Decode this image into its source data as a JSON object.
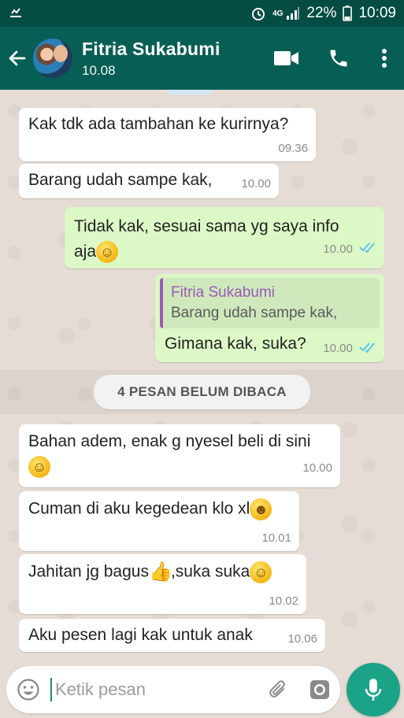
{
  "status_bar": {
    "network": "4G",
    "battery": "22%",
    "clock": "10:09"
  },
  "header": {
    "contact_name": "Fitria Sukabumi",
    "last_seen": "10.08"
  },
  "messages": [
    {
      "dir": "in",
      "text": "Kak tdk ada tambahan ke kurirnya?",
      "time": "09.36"
    },
    {
      "dir": "in",
      "text": "Barang udah sampe kak,",
      "time": "10.00"
    },
    {
      "dir": "out",
      "text": "Tidak kak, sesuai sama yg saya info",
      "text2": "aja",
      "emoji": "smile",
      "time": "10.00"
    },
    {
      "dir": "out",
      "quote_name": "Fitria Sukabumi",
      "quote_text": "Barang udah sampe kak,",
      "text": "Gimana kak, suka?",
      "time": "10.00"
    },
    {
      "dir": "in",
      "text": "Bahan adem, enak g nyesel beli di sini",
      "emoji": "blush",
      "time": "10.00"
    },
    {
      "dir": "in",
      "text": "Cuman di aku kegedean klo xl",
      "emoji": "hand-over-mouth",
      "time": "10.01"
    },
    {
      "dir": "in",
      "text": "Jahitan jg bagus",
      "text2": ",suka suka",
      "emoji": "thumbs-up",
      "emoji2": "halo",
      "time": "10.02"
    },
    {
      "dir": "in",
      "text": "Aku pesen lagi kak untuk anak",
      "time": "10.06"
    }
  ],
  "unread_divider": "4 PESAN BELUM DIBACA",
  "composer": {
    "placeholder": "Ketik pesan"
  },
  "colors": {
    "header": "#075e54",
    "status_bar": "#054d44",
    "outgoing_bubble": "#dcf8c6",
    "incoming_bubble": "#ffffff",
    "read_ticks": "#4fc3f7",
    "mic_button": "#1aa386"
  },
  "icons": [
    "back-arrow-icon",
    "video-call-icon",
    "phone-icon",
    "more-vert-icon",
    "emoji-icon",
    "attach-icon",
    "camera-icon",
    "mic-icon"
  ]
}
